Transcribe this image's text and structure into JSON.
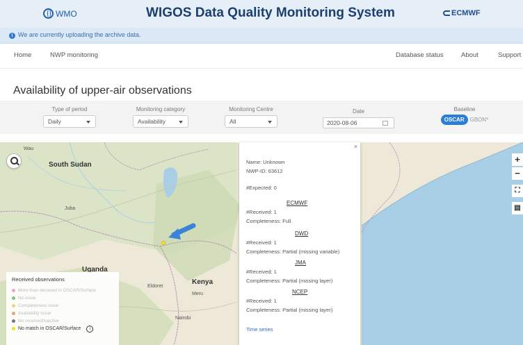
{
  "header": {
    "wmo_label": "WMO",
    "title": "WIGOS Data Quality Monitoring System",
    "ecmwf_label": "ECMWF"
  },
  "banner": {
    "text": "We are currently uploading the archive data."
  },
  "nav": {
    "home": "Home",
    "nwp": "NWP monitoring",
    "db_status": "Database status",
    "about": "About",
    "support": "Support"
  },
  "page_title": "Availability of upper-air observations",
  "filters": {
    "period_label": "Type of period",
    "period_value": "Daily",
    "category_label": "Monitoring category",
    "category_value": "Availability",
    "centre_label": "Monitoring Centre",
    "centre_value": "All",
    "date_label": "Date",
    "date_value": "2020-08-06",
    "baseline_label": "Baseline",
    "baseline_on": "OSCAR",
    "baseline_off": "GBON*"
  },
  "map": {
    "labels": {
      "south_sudan": "South Sudan",
      "juba": "Juba",
      "uganda": "Uganda",
      "kenya": "Kenya",
      "eldoret": "Eldoret",
      "meru": "Meru",
      "nairobi": "Nairobi",
      "wau": "Wau"
    },
    "controls": {
      "zoom_in": "+",
      "zoom_out": "−"
    },
    "accent": "#3b82d9"
  },
  "legend": {
    "title": "Received observations",
    "items": [
      {
        "label": "More than declared in OSCAR/Surface",
        "color": "#e9a6c7"
      },
      {
        "label": "No issue",
        "color": "#7bc67b"
      },
      {
        "label": "Completeness issue",
        "color": "#f5cf7a"
      },
      {
        "label": "Availability issue",
        "color": "#f2a06a"
      },
      {
        "label": "No received/Inactive",
        "color": "#777777"
      },
      {
        "label": "No match in OSCAR/Surface",
        "color": "#f1e01e"
      }
    ]
  },
  "popup": {
    "close": "×",
    "name": "Name: Unknown",
    "nwp_id": "NWP-ID: 63612",
    "expected": "#Expected: 0",
    "centres": [
      {
        "name": "ECMWF",
        "received": "#Received: 1",
        "completeness": "Completeness: Full"
      },
      {
        "name": "DWD",
        "received": "#Received: 1",
        "completeness": "Completeness: Partial (missing variable)"
      },
      {
        "name": "JMA",
        "received": "#Received: 1",
        "completeness": "Completeness: Partial (missing layer)"
      },
      {
        "name": "NCEP",
        "received": "#Received: 1",
        "completeness": "Completeness: Partial (missing layer)"
      }
    ],
    "time_series": "Time series"
  }
}
